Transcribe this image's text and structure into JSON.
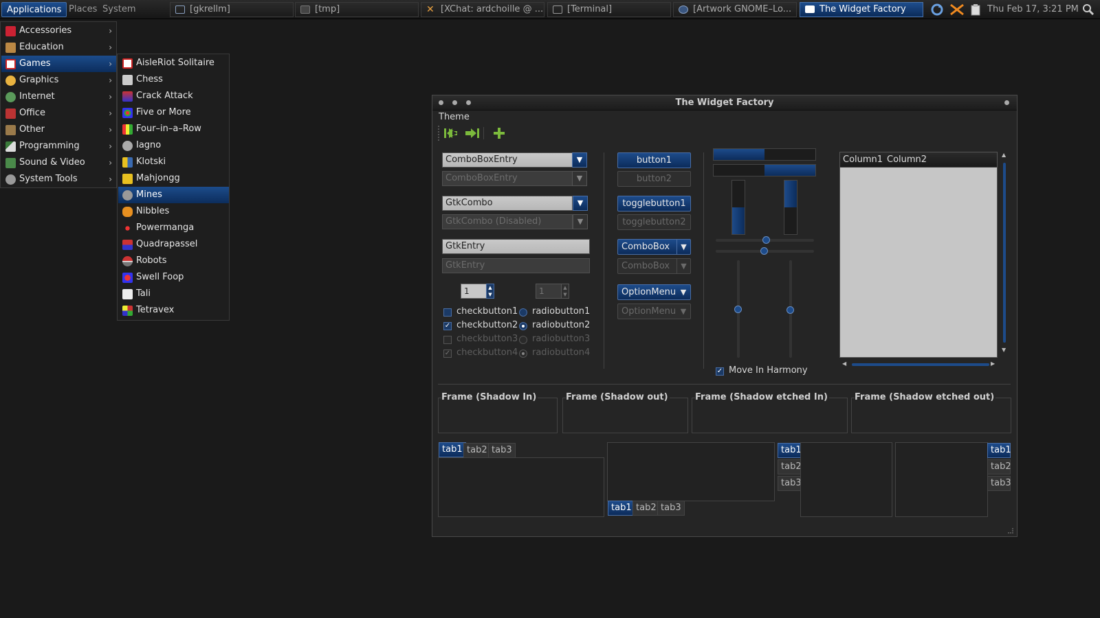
{
  "panel": {
    "menus": [
      "Applications",
      "Places",
      "System"
    ],
    "tasks": [
      "[gkrellm]",
      "[tmp]",
      "[XChat: ardchoille @ ...",
      "[Terminal]",
      "[Artwork GNOME–Lo...",
      "The Widget Factory"
    ],
    "clock": "Thu Feb 17,  3:21 PM"
  },
  "app_menu": {
    "items": [
      "Accessories",
      "Education",
      "Games",
      "Graphics",
      "Internet",
      "Office",
      "Other",
      "Programming",
      "Sound & Video",
      "System Tools"
    ],
    "selected": "Games"
  },
  "games_menu": {
    "items": [
      "AisleRiot Solitaire",
      "Chess",
      "Crack Attack",
      "Five or More",
      "Four–in–a–Row",
      "Iagno",
      "Klotski",
      "Mahjongg",
      "Mines",
      "Nibbles",
      "Powermanga",
      "Quadrapassel",
      "Robots",
      "Swell Foop",
      "Tali",
      "Tetravex"
    ],
    "selected": "Mines"
  },
  "window": {
    "title": "The Widget Factory",
    "menubar": "Theme",
    "combo_entry_1": "ComboBoxEntry",
    "combo_entry_2": "ComboBoxEntry",
    "gtk_combo": "GtkCombo",
    "gtk_combo_disabled": "GtkCombo (Disabled)",
    "entry_1": "GtkEntry",
    "entry_2": "GtkEntry",
    "spin_1": "1",
    "spin_2": "1",
    "checks": [
      "checkbutton1",
      "checkbutton2",
      "checkbutton3",
      "checkbutton4"
    ],
    "radios": [
      "radiobutton1",
      "radiobutton2",
      "radiobutton3",
      "radiobutton4"
    ],
    "button1": "button1",
    "button2": "button2",
    "togglebutton1": "togglebutton1",
    "togglebutton2": "togglebutton2",
    "combobox_1": "ComboBox",
    "combobox_2": "ComboBox",
    "optionmenu_1": "OptionMenu",
    "optionmenu_2": "OptionMenu",
    "move_in_harmony": "Move In Harmony",
    "tree_columns": [
      "Column1",
      "Column2"
    ],
    "frames": [
      "Frame (Shadow In)",
      "Frame (Shadow out)",
      "Frame (Shadow etched In)",
      "Frame (Shadow etched out)"
    ],
    "tabs": [
      "tab1",
      "tab2",
      "tab3"
    ],
    "progress_1": 0.5,
    "progress_2": 0.5,
    "vprogress_1": 0.5,
    "vprogress_2": 0.5
  },
  "colors": {
    "selection": "#0c2d5c",
    "accent": "#1d4b8a",
    "background": "#1a1a1a"
  }
}
